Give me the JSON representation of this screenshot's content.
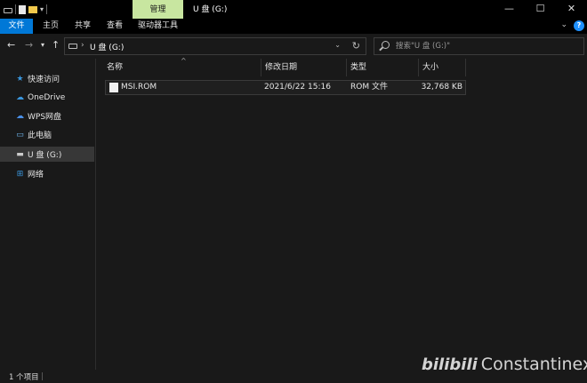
{
  "titlebar": {
    "context_tab": "管理",
    "window_title": "U 盘 (G:)",
    "controls": [
      "minimize",
      "maximize",
      "close"
    ]
  },
  "ribbon": {
    "tabs": [
      "文件",
      "主页",
      "共享",
      "查看",
      "驱动器工具"
    ]
  },
  "address": {
    "path": "U 盘 (G:)",
    "search_placeholder": "搜索\"U 盘 (G:)\""
  },
  "sidebar": {
    "items": [
      {
        "label": "快速访问",
        "icon": "star-icon"
      },
      {
        "label": "OneDrive",
        "icon": "cloud-icon"
      },
      {
        "label": "WPS网盘",
        "icon": "cloud-icon"
      },
      {
        "label": "此电脑",
        "icon": "computer-icon"
      },
      {
        "label": "U 盘 (G:)",
        "icon": "usb-drive-icon",
        "selected": true
      },
      {
        "label": "网络",
        "icon": "network-icon"
      }
    ]
  },
  "table": {
    "headers": [
      "名称",
      "修改日期",
      "类型",
      "大小"
    ],
    "rows": [
      {
        "name": "MSI.ROM",
        "modified": "2021/6/22 15:16",
        "type": "ROM 文件",
        "size": "32,768 KB"
      }
    ]
  },
  "status": {
    "count": "1 个项目"
  },
  "watermark": {
    "logo": "bilibili",
    "text": "Constantinex"
  }
}
